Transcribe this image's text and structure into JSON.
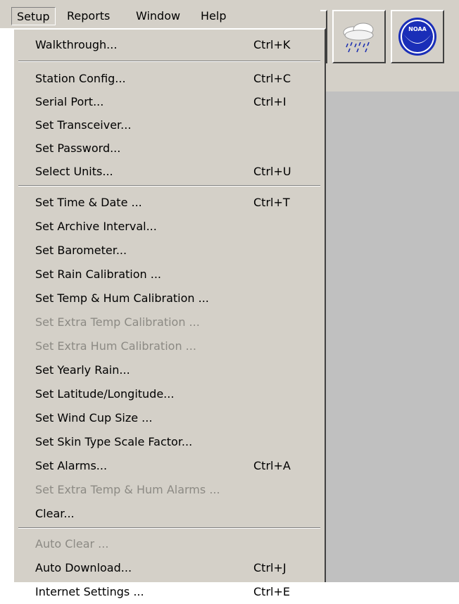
{
  "menubar": {
    "items": [
      {
        "label": "Setup"
      },
      {
        "label": "Reports"
      },
      {
        "label": "Window"
      },
      {
        "label": "Help"
      }
    ]
  },
  "toolbar": {
    "icons": [
      "rain-cloud-icon",
      "noaa-logo-icon"
    ],
    "noaa_text": "NOAA"
  },
  "colors": {
    "menu_background": "#d4d0c8",
    "workspace_background": "#c0c0c0",
    "disabled_text": "#8c8a84",
    "noaa_blue": "#1a2eb8"
  },
  "setup_menu": {
    "items": [
      {
        "label": "Walkthrough...",
        "shortcut": "Ctrl+K",
        "enabled": true
      },
      {
        "label": "Station Config...",
        "shortcut": "Ctrl+C",
        "enabled": true
      },
      {
        "label": "Serial Port...",
        "shortcut": "Ctrl+I",
        "enabled": true
      },
      {
        "label": "Set Transceiver...",
        "shortcut": "",
        "enabled": true
      },
      {
        "label": "Set Password...",
        "shortcut": "",
        "enabled": true
      },
      {
        "label": "Select Units...",
        "shortcut": "Ctrl+U",
        "enabled": true
      },
      {
        "label": "Set Time & Date ...",
        "shortcut": "Ctrl+T",
        "enabled": true
      },
      {
        "label": "Set Archive Interval...",
        "shortcut": "",
        "enabled": true
      },
      {
        "label": "Set Barometer...",
        "shortcut": "",
        "enabled": true
      },
      {
        "label": "Set Rain Calibration ...",
        "shortcut": "",
        "enabled": true
      },
      {
        "label": "Set Temp & Hum Calibration ...",
        "shortcut": "",
        "enabled": true
      },
      {
        "label": "Set Extra Temp Calibration ...",
        "shortcut": "",
        "enabled": false
      },
      {
        "label": "Set Extra Hum Calibration ...",
        "shortcut": "",
        "enabled": false
      },
      {
        "label": "Set Yearly Rain...",
        "shortcut": "",
        "enabled": true
      },
      {
        "label": "Set Latitude/Longitude...",
        "shortcut": "",
        "enabled": true
      },
      {
        "label": "Set Wind Cup Size ...",
        "shortcut": "",
        "enabled": true
      },
      {
        "label": "Set Skin Type Scale Factor...",
        "shortcut": "",
        "enabled": true
      },
      {
        "label": "Set Alarms...",
        "shortcut": "Ctrl+A",
        "enabled": true
      },
      {
        "label": "Set Extra Temp & Hum Alarms ...",
        "shortcut": "",
        "enabled": false
      },
      {
        "label": "Clear...",
        "shortcut": "",
        "enabled": true
      },
      {
        "label": "Auto Clear ...",
        "shortcut": "",
        "enabled": false
      },
      {
        "label": "Auto Download...",
        "shortcut": "Ctrl+J",
        "enabled": true
      },
      {
        "label": "Internet Settings ...",
        "shortcut": "Ctrl+E",
        "enabled": true
      }
    ]
  }
}
